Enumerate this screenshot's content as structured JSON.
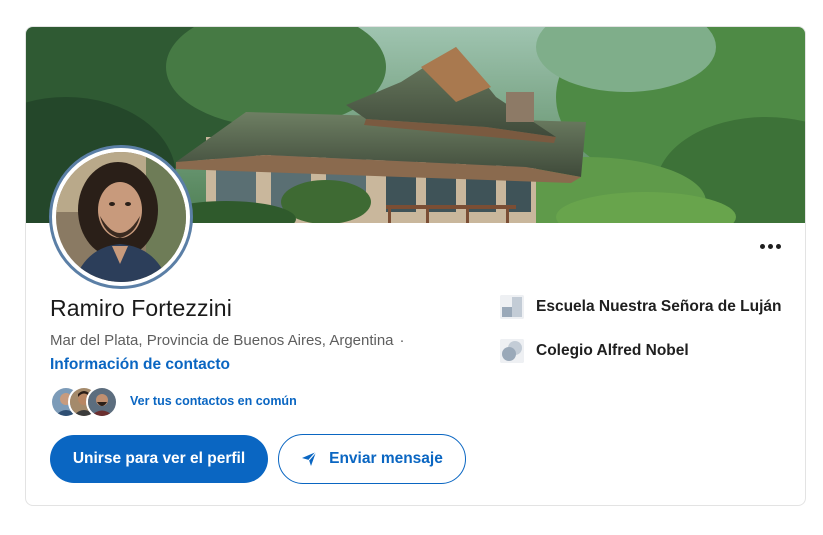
{
  "profile": {
    "name": "Ramiro Fortezzini",
    "location": "Mar del Plata, Provincia de Buenos Aires, Argentina",
    "location_separator": "·",
    "contact_link": "Información de contacto",
    "mutual_connections_text": "Ver tus contactos en común",
    "mutual_connections_faces": 3
  },
  "actions": {
    "join_label": "Unirse para ver el perfil",
    "message_label": "Enviar mensaje",
    "more_icon": "more-horizontal-icon",
    "message_icon": "send-icon"
  },
  "education": [
    {
      "name": "Escuela Nuestra Señora de Luján",
      "logo": "school-logo-placeholder"
    },
    {
      "name": "Colegio Alfred Nobel",
      "logo": "school-logo-placeholder"
    }
  ],
  "colors": {
    "accent": "#0a66c2",
    "name_text": "#1a1a1a",
    "secondary_text": "#5e5e5e",
    "avatar_ring": "#5b7fa6"
  }
}
